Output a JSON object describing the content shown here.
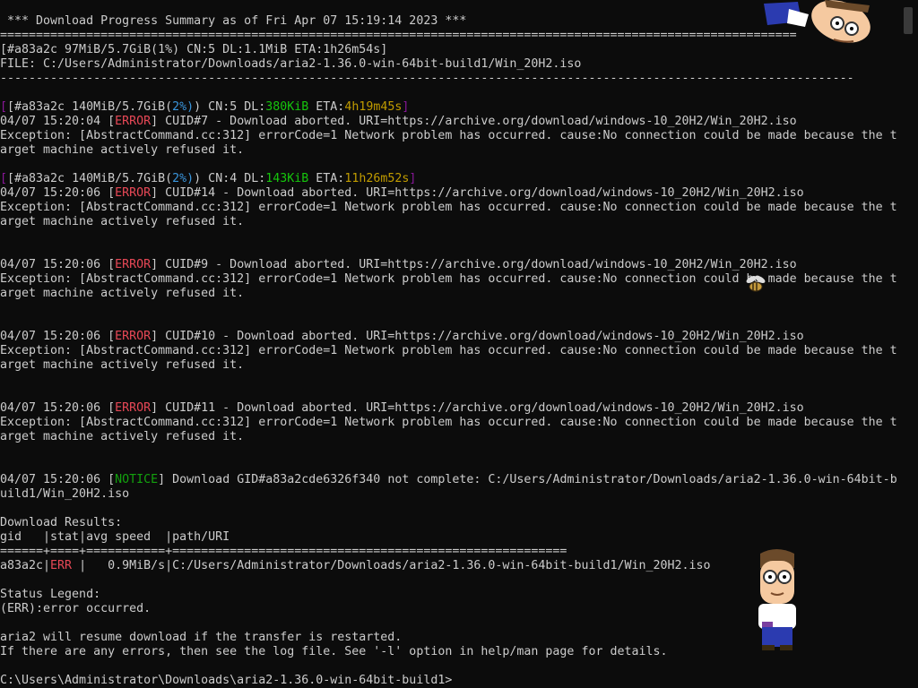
{
  "terminal": {
    "header": " *** Download Progress Summary as of Fri Apr 07 15:19:14 2023 ***",
    "rule_double": "===============================================================================================================",
    "progress_line_1": "[#a83a2c 97MiB/5.7GiB(1%) CN:5 DL:1.1MiB ETA:1h26m54s]",
    "file_line": "FILE: C:/Users/Administrator/Downloads/aria2-1.36.0-win-64bit-build1/Win_20H2.iso",
    "rule_single": "-----------------------------------------------------------------------------------------------------------------------",
    "progress_2": {
      "gid": "[#a83a2c 140MiB/5.7GiB(",
      "pct": "2%",
      "cn": ") CN:5 DL:",
      "dl": "380KiB",
      "eta_label": " ETA:",
      "eta": "4h19m45s",
      "close": "]"
    },
    "progress_3": {
      "gid": "[#a83a2c 140MiB/5.7GiB(",
      "pct": "2%",
      "cn": ") CN:4 DL:",
      "dl": "143KiB",
      "eta_label": " ETA:",
      "eta": "11h26m52s",
      "close": "]"
    },
    "errors": [
      {
        "time": "04/07 15:20:04 [",
        "level": "ERROR",
        "msg": "] CUID#7 - Download aborted. URI=https://archive.org/download/windows-10_20H2/Win_20H2.iso"
      },
      {
        "time": "04/07 15:20:06 [",
        "level": "ERROR",
        "msg": "] CUID#14 - Download aborted. URI=https://archive.org/download/windows-10_20H2/Win_20H2.iso"
      },
      {
        "time": "04/07 15:20:06 [",
        "level": "ERROR",
        "msg": "] CUID#9 - Download aborted. URI=https://archive.org/download/windows-10_20H2/Win_20H2.iso"
      },
      {
        "time": "04/07 15:20:06 [",
        "level": "ERROR",
        "msg": "] CUID#10 - Download aborted. URI=https://archive.org/download/windows-10_20H2/Win_20H2.iso"
      },
      {
        "time": "04/07 15:20:06 [",
        "level": "ERROR",
        "msg": "] CUID#11 - Download aborted. URI=https://archive.org/download/windows-10_20H2/Win_20H2.iso"
      }
    ],
    "exception_1": "Exception: [AbstractCommand.cc:312] errorCode=1 Network problem has occurred. cause:No connection could be made because the t",
    "exception_2": "arget machine actively refused it.",
    "notice": {
      "time": "04/07 15:20:06 [",
      "level": "NOTICE",
      "msg": "] Download GID#a83a2cde6326f340 not complete: C:/Users/Administrator/Downloads/aria2-1.36.0-win-64bit-b",
      "cont": "uild1/Win_20H2.iso"
    },
    "results_title": "Download Results:",
    "results_header": "gid   |stat|avg speed  |path/URI",
    "results_rule": "======+====+===========+=======================================================",
    "result_row": {
      "gid": "a83a2c|",
      "stat": "ERR",
      "rest": " |   0.9MiB/s|C:/Users/Administrator/Downloads/aria2-1.36.0-win-64bit-build1/Win_20H2.iso"
    },
    "legend_title": "Status Legend:",
    "legend_err": "(ERR):error occurred.",
    "resume_note": "aria2 will resume download if the transfer is restarted.",
    "log_note": "If there are any errors, then see the log file. See '-l' option in help/man page for details.",
    "prompt": "C:\\Users\\Administrator\\Downloads\\aria2-1.36.0-win-64bit-build1>"
  }
}
